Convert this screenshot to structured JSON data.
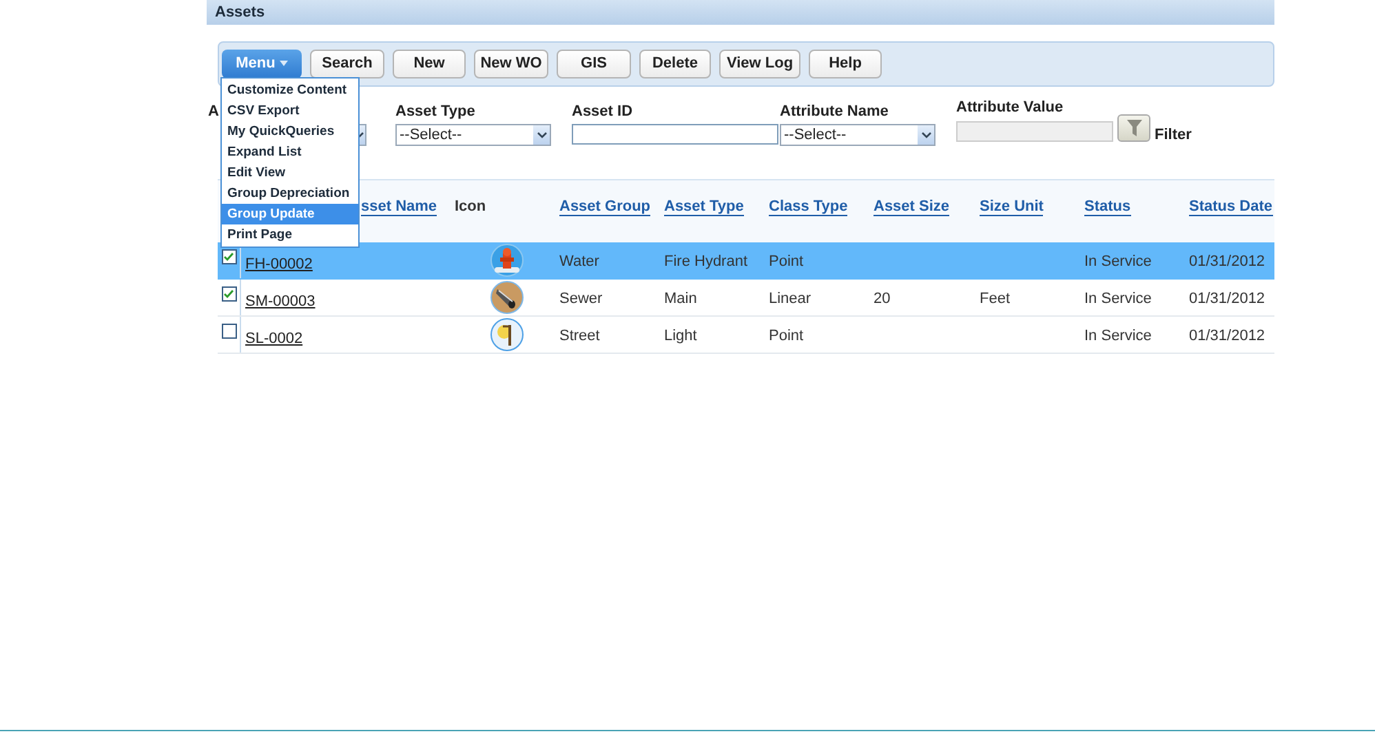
{
  "header": {
    "title": "Assets"
  },
  "toolbar": {
    "buttons": [
      {
        "label": "Menu",
        "kind": "menu"
      },
      {
        "label": "Search",
        "kind": "plain"
      },
      {
        "label": "New",
        "kind": "plain"
      },
      {
        "label": "New WO",
        "kind": "plain"
      },
      {
        "label": "GIS",
        "kind": "plain"
      },
      {
        "label": "Delete",
        "kind": "plain"
      },
      {
        "label": "View Log",
        "kind": "plain"
      },
      {
        "label": "Help",
        "kind": "plain"
      }
    ]
  },
  "menu": {
    "items": [
      {
        "label": "Customize Content",
        "selected": false
      },
      {
        "label": "CSV Export",
        "selected": false
      },
      {
        "label": "My QuickQueries",
        "selected": false
      },
      {
        "label": "Expand List",
        "selected": false
      },
      {
        "label": "Edit View",
        "selected": false
      },
      {
        "label": "Group Depreciation",
        "selected": false
      },
      {
        "label": "Group Update",
        "selected": true
      },
      {
        "label": "Print Page",
        "selected": false
      }
    ]
  },
  "filters": [
    {
      "label": "A",
      "kind": "covered"
    },
    {
      "label": "Asset Type",
      "kind": "select",
      "value": "--Select--"
    },
    {
      "label": "Asset ID",
      "kind": "text"
    },
    {
      "label": "Attribute Name",
      "kind": "select",
      "value": "--Select--"
    },
    {
      "label": "Attribute Value",
      "kind": "filter",
      "disabled": true,
      "button_label": "Filter"
    }
  ],
  "table": {
    "columns": [
      "sset Name",
      "Icon",
      "Asset Group",
      "Asset Type",
      "Class Type",
      "Asset Size",
      "Size Unit",
      "Status",
      "Status Date"
    ],
    "rows": [
      {
        "checked": true,
        "selected": true,
        "asset_name": "FH-00002",
        "icon": {
          "kind": "hydrant"
        },
        "asset_group": "Water",
        "asset_type": "Fire Hydrant",
        "class_type": "Point",
        "status": "In Service",
        "status_date": "01/31/2012"
      },
      {
        "checked": true,
        "selected": false,
        "asset_name": "SM-00003",
        "icon": {
          "kind": "pipe"
        },
        "asset_group": "Sewer",
        "asset_type": "Main",
        "class_type": "Linear",
        "asset_size": "20",
        "size_unit": "Feet",
        "status": "In Service",
        "status_date": "01/31/2012"
      },
      {
        "checked": false,
        "selected": false,
        "asset_name": "SL-0002",
        "icon": {
          "kind": "lamp"
        },
        "asset_group": "Street",
        "asset_type": "Light",
        "class_type": "Point",
        "status": "In Service",
        "status_date": "01/31/2012"
      }
    ]
  }
}
